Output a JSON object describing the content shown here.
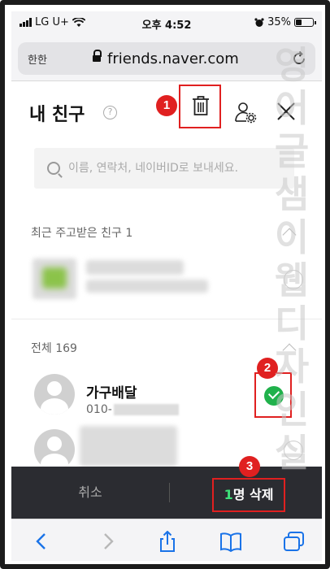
{
  "status_bar": {
    "carrier": "LG U+",
    "time": "오후 4:52",
    "battery": "35%",
    "battery_level": 0.35
  },
  "browser": {
    "text_size_label": "한한",
    "domain": "friends.naver.com"
  },
  "header": {
    "title": "내 친구",
    "help_icon": "question-icon",
    "delete_icon": "trash-icon",
    "manage_icon": "user-settings-icon",
    "close_icon": "close-icon"
  },
  "search": {
    "placeholder": "이름, 연락처, 네이버ID로 보내세요."
  },
  "sections": {
    "recent_label": "최근 주고받은 친구 1",
    "all_label": "전체 169"
  },
  "friends": [
    {
      "name": "가구배달",
      "phone": "010-",
      "selected": true
    }
  ],
  "actions": {
    "cancel_label": "취소",
    "delete_count": "1",
    "delete_label": "명 삭제"
  },
  "annotations": {
    "step1": "1",
    "step2": "2",
    "step3": "3"
  },
  "watermark": "영어글샘이웹디자인실",
  "colors": {
    "accent_red": "#e02020",
    "check_green": "#20b14b",
    "count_green": "#3ee27a",
    "action_bar": "#2b2c31"
  }
}
